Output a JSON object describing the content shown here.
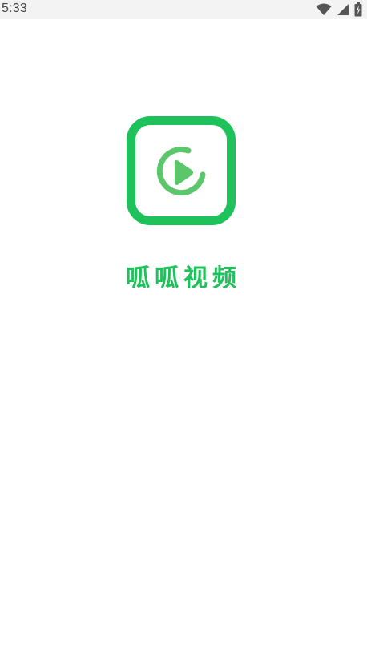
{
  "status_bar": {
    "time": "5:33",
    "icons": [
      "wifi-icon",
      "cell-signal-icon",
      "battery-charging-icon"
    ]
  },
  "splash": {
    "logo_icon": "video-play-logo-icon",
    "app_name": "呱呱视频",
    "colors": {
      "brand_green": "#1fc25a",
      "play_green": "#5cc76a",
      "background": "#ffffff"
    }
  }
}
